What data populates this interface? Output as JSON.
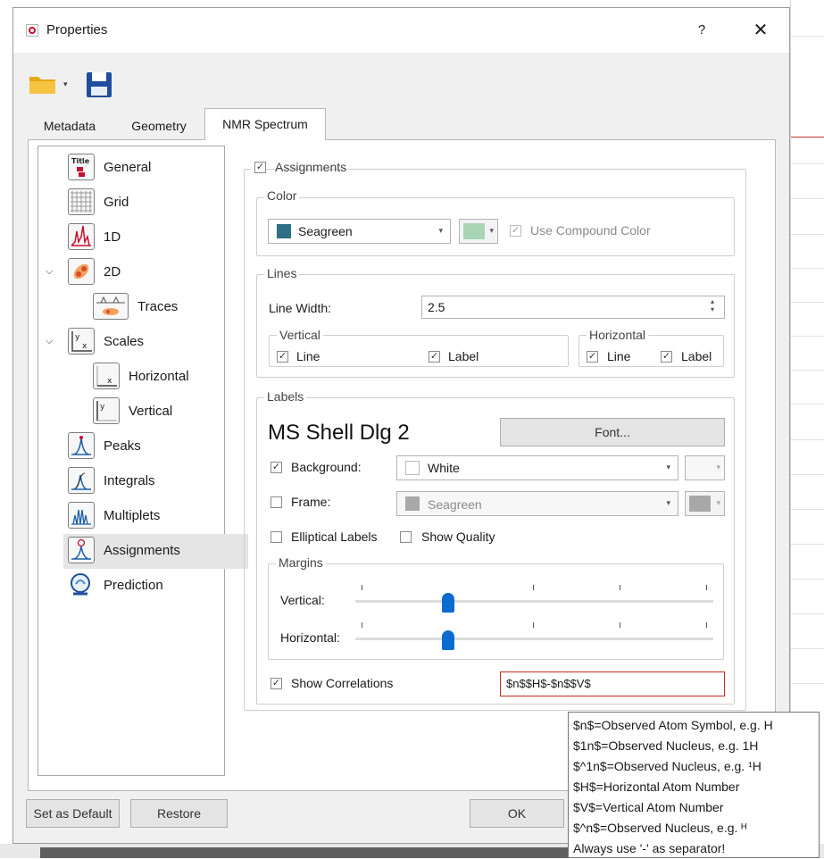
{
  "window": {
    "title": "Properties",
    "help_label": "?",
    "close_label": "✕"
  },
  "toolbar": {
    "open_icon": "folder-icon",
    "save_icon": "save-icon",
    "dropdown_glyph": "▾"
  },
  "tabs": [
    {
      "label": "Metadata",
      "active": false
    },
    {
      "label": "Geometry",
      "active": false
    },
    {
      "label": "NMR Spectrum",
      "active": true
    }
  ],
  "tree": [
    {
      "label": "General",
      "icon": "title-icon"
    },
    {
      "label": "Grid",
      "icon": "grid-icon"
    },
    {
      "label": "1D",
      "icon": "spectrum-1d-icon"
    },
    {
      "label": "2D",
      "icon": "spectrum-2d-icon",
      "expanded": true
    },
    {
      "label": "Traces",
      "icon": "traces-icon"
    },
    {
      "label": "Scales",
      "icon": "scales-icon",
      "expanded": true
    },
    {
      "label": "Horizontal",
      "icon": "horizontal-scale-icon"
    },
    {
      "label": "Vertical",
      "icon": "vertical-scale-icon"
    },
    {
      "label": "Peaks",
      "icon": "peaks-icon"
    },
    {
      "label": "Integrals",
      "icon": "integrals-icon"
    },
    {
      "label": "Multiplets",
      "icon": "multiplets-icon"
    },
    {
      "label": "Assignments",
      "icon": "assignments-icon",
      "selected": true
    },
    {
      "label": "Prediction",
      "icon": "prediction-icon"
    }
  ],
  "assignments": {
    "enabled_label": "Assignments",
    "color": {
      "legend": "Color",
      "value": "Seagreen",
      "swatch": "#2e6f86",
      "compound_swatch": "#a8d5b5",
      "use_compound_label": "Use Compound Color"
    },
    "lines": {
      "legend": "Lines",
      "width_label": "Line Width:",
      "width_value": "2.5",
      "vertical_legend": "Vertical",
      "horizontal_legend": "Horizontal",
      "line_label": "Line",
      "label_label": "Label"
    },
    "labels": {
      "legend": "Labels",
      "font_name": "MS Shell Dlg 2",
      "font_button": "Font...",
      "background_label": "Background:",
      "background_value": "White",
      "frame_label": "Frame:",
      "frame_value": "Seagreen",
      "frame_swatch": "#a8a8a8",
      "elliptical_label": "Elliptical Labels",
      "quality_label": "Show Quality",
      "margins_legend": "Margins",
      "vertical_label": "Vertical:",
      "horizontal_label": "Horizontal:",
      "vertical_margin_fraction": 0.25,
      "horizontal_margin_fraction": 0.25
    },
    "correlations_label": "Show Correlations",
    "correlations_value": "$n$$H$-$n$$V$"
  },
  "tooltip": [
    "$n$=Observed Atom Symbol, e.g. H",
    "$1n$=Observed Nucleus, e.g. 1H",
    "$^1n$=Observed Nucleus, e.g. ¹H",
    "$H$=Horizontal Atom Number",
    "$V$=Vertical Atom Number",
    "$^n$=Observed Nucleus, e.g. ᴴ",
    "Always use '-' as separator!"
  ],
  "buttons": {
    "set_default": "Set as Default",
    "restore": "Restore",
    "ok": "OK"
  },
  "colors": {
    "accent": "#0a6bd1",
    "error_border": "#c42b1c"
  }
}
